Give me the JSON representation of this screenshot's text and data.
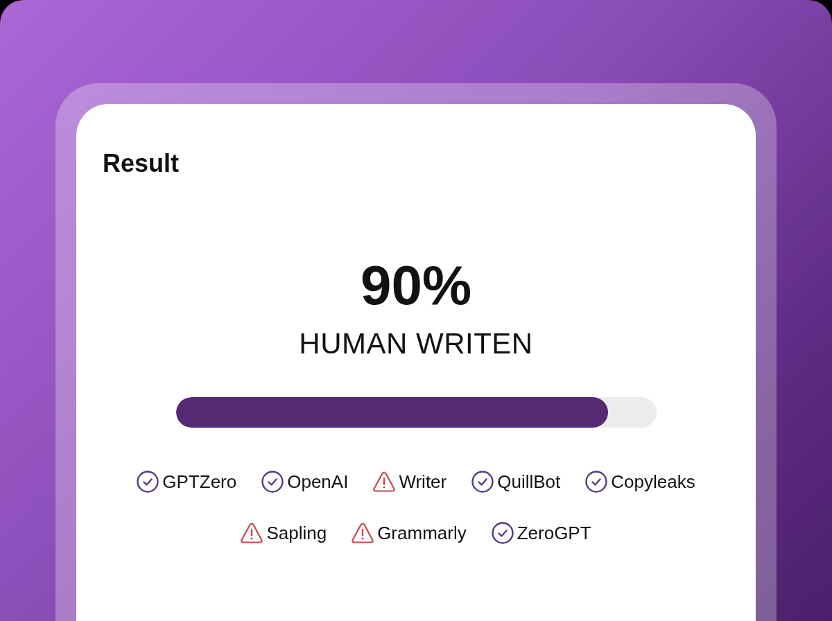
{
  "title": "Result",
  "score": {
    "value": "90%",
    "label": "HUMAN WRITEN",
    "level": 0.9
  },
  "detectors": [
    {
      "name": "GPTZero",
      "flagged": false
    },
    {
      "name": "OpenAI",
      "flagged": false
    },
    {
      "name": "Writer",
      "flagged": true
    },
    {
      "name": "QuillBot",
      "flagged": false
    },
    {
      "name": "Copyleaks",
      "flagged": false
    },
    {
      "name": "Sapling",
      "flagged": true
    },
    {
      "name": "Grammarly",
      "flagged": true
    },
    {
      "name": "ZeroGPT",
      "flagged": false
    }
  ]
}
